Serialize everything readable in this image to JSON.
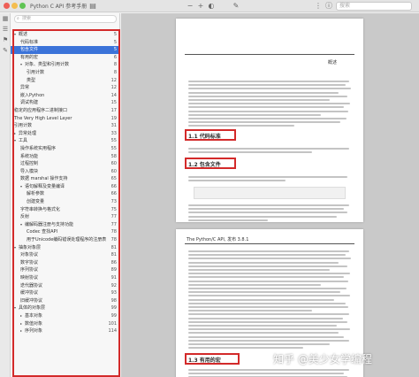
{
  "window": {
    "title": "Python C API 参考手册"
  },
  "search": {
    "placeholder": "搜索"
  },
  "sidebar": {
    "search_placeholder": "搜索",
    "items": [
      {
        "label": "概述",
        "page": "5",
        "indent": 0,
        "arrow": "▾"
      },
      {
        "label": "代码标准",
        "page": "5",
        "indent": 1
      },
      {
        "label": "包含文件",
        "page": "5",
        "indent": 1,
        "selected": true
      },
      {
        "label": "有用的宏",
        "page": "6",
        "indent": 1
      },
      {
        "label": "对象、类型和引用计数",
        "page": "8",
        "indent": 1,
        "arrow": "▾"
      },
      {
        "label": "引用计数",
        "page": "8",
        "indent": 2
      },
      {
        "label": "类型",
        "page": "12",
        "indent": 2
      },
      {
        "label": "异常",
        "page": "12",
        "indent": 1
      },
      {
        "label": "嵌入Python",
        "page": "14",
        "indent": 1
      },
      {
        "label": "调试构建",
        "page": "15",
        "indent": 1
      },
      {
        "label": "稳定的应用程序二进制接口",
        "page": "17",
        "indent": 0
      },
      {
        "label": "The Very High Level Layer",
        "page": "19",
        "indent": 0
      },
      {
        "label": "引用计数",
        "page": "31",
        "indent": 0
      },
      {
        "label": "异常处理",
        "page": "33",
        "indent": 0,
        "arrow": "▸"
      },
      {
        "label": "工具",
        "page": "55",
        "indent": 0,
        "arrow": "▾"
      },
      {
        "label": "操作系统实用程序",
        "page": "55",
        "indent": 1
      },
      {
        "label": "系统功能",
        "page": "58",
        "indent": 1
      },
      {
        "label": "过程控制",
        "page": "60",
        "indent": 1
      },
      {
        "label": "导入模块",
        "page": "60",
        "indent": 1
      },
      {
        "label": "数据 marshal 操作支持",
        "page": "65",
        "indent": 1
      },
      {
        "label": "语句解释及变量编译",
        "page": "66",
        "indent": 1,
        "arrow": "▾"
      },
      {
        "label": "解析参数",
        "page": "66",
        "indent": 2
      },
      {
        "label": "创建变量",
        "page": "73",
        "indent": 2
      },
      {
        "label": "字符串转换与格式化",
        "page": "75",
        "indent": 1
      },
      {
        "label": "反射",
        "page": "77",
        "indent": 1
      },
      {
        "label": "编解码器注册与支持功能",
        "page": "77",
        "indent": 1,
        "arrow": "▾"
      },
      {
        "label": "Codec 查找API",
        "page": "78",
        "indent": 2
      },
      {
        "label": "用于Unicode编码错误处理程序的注册表",
        "page": "78",
        "indent": 2
      },
      {
        "label": "抽象对象层",
        "page": "81",
        "indent": 0,
        "arrow": "▾"
      },
      {
        "label": "对象协议",
        "page": "81",
        "indent": 1
      },
      {
        "label": "数字协议",
        "page": "86",
        "indent": 1
      },
      {
        "label": "序列协议",
        "page": "89",
        "indent": 1
      },
      {
        "label": "映射协议",
        "page": "91",
        "indent": 1
      },
      {
        "label": "迭代器协议",
        "page": "92",
        "indent": 1
      },
      {
        "label": "缓冲协议",
        "page": "93",
        "indent": 1
      },
      {
        "label": "旧缓冲协议",
        "page": "98",
        "indent": 1
      },
      {
        "label": "具体的对象层",
        "page": "99",
        "indent": 0,
        "arrow": "▾"
      },
      {
        "label": "基本对象",
        "page": "99",
        "indent": 1,
        "arrow": "▸"
      },
      {
        "label": "数值对象",
        "page": "101",
        "indent": 1,
        "arrow": "▸"
      },
      {
        "label": "序列对象",
        "page": "114",
        "indent": 1,
        "arrow": "▸"
      }
    ]
  },
  "doc": {
    "page1": {
      "header_right": "概述",
      "section1": "1.1 代码标准",
      "section2": "1.2 包含文件"
    },
    "page2": {
      "header_left": "The Python/C API, 发布 3.8.1",
      "section3": "1.3 有用的宏"
    }
  },
  "watermark": {
    "text": "知乎 @美少女学编程"
  },
  "colors": {
    "selection": "#3b73d9",
    "highlight_box": "#d32a2a"
  }
}
